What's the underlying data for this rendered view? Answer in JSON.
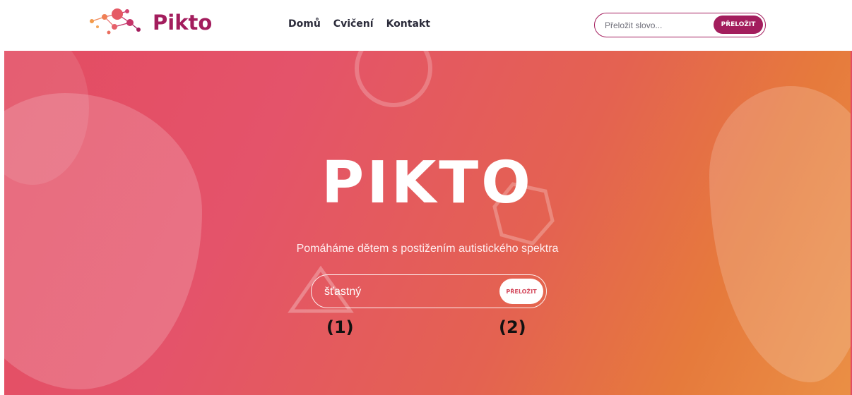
{
  "header": {
    "logo_text": "Pikto",
    "nav": [
      "Domů",
      "Cvičení",
      "Kontakt"
    ],
    "search_placeholder": "Přeložit slovo...",
    "search_button": "PŘELOŽIT"
  },
  "hero": {
    "title": "PIKTO",
    "subtitle": "Pomáháme dětem s postižením autistického spektra",
    "input_value": "šťastný",
    "button_label": "PŘELOŽIT",
    "annotation_1": "(1)",
    "annotation_2": "(2)"
  },
  "colors": {
    "brand": "#a31d5d",
    "hero_start": "#e34c62",
    "hero_end": "#ea8f45"
  },
  "icons": [
    "pikto-logo-icon"
  ]
}
